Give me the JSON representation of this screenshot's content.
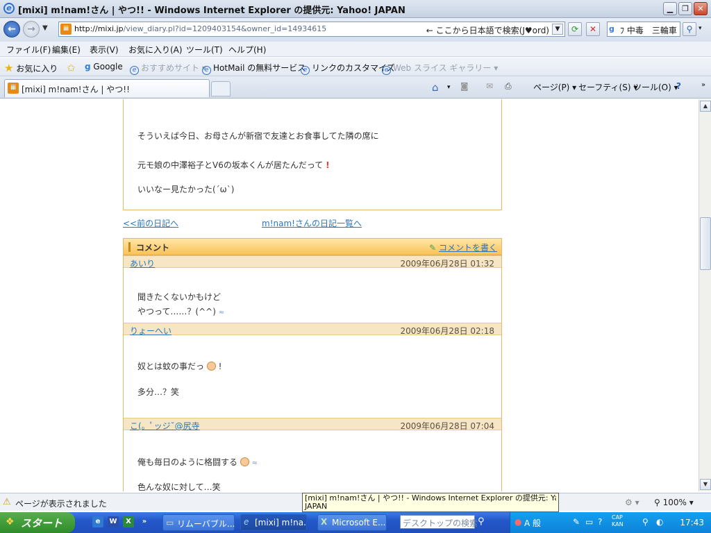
{
  "window": {
    "title": "[mixi] m!nam!さん | やつ!! - Windows Internet Explorer の提供元: Yahoo! JAPAN"
  },
  "address": {
    "host": "http://mixi.jp",
    "path": "/view_diary.pl?id=1209403154&owner_id=14934615",
    "jword": "← ここから日本語で検索(J♥ord)"
  },
  "search": {
    "value": "ﾌ 中毒　三輪車"
  },
  "menu": [
    "ファイル(F)",
    "編集(E)",
    "表示(V)",
    "お気に入り(A)",
    "ツール(T)",
    "ヘルプ(H)"
  ],
  "favorites_bar": {
    "favorites": "お気に入り",
    "items": [
      "Google",
      "おすすめサイト ▾",
      "HotMail の無料サービス",
      "リンクのカスタマイズ",
      "Web スライス ギャラリー ▾"
    ]
  },
  "tab": {
    "label": "[mixi] m!nam!さん | やつ!!"
  },
  "command_bar": {
    "page": "ページ(P) ▾",
    "safety": "セーフティ(S) ▾",
    "tools": "ツール(O) ▾"
  },
  "diary": {
    "lines": [
      "そういえば今日、お母さんが新宿で友達とお食事してた隣の席に",
      "元モ娘の中澤裕子とV6の坂本くんが居たんだって",
      "いいなー見たかった(´ω`)"
    ],
    "prev_link": "<<前の日記へ",
    "list_link": "m!nam!さんの日記一覧へ"
  },
  "comments": {
    "title": "コメント",
    "write_link": "コメントを書く",
    "items": [
      {
        "name": "あいり",
        "date": "2009年06月28日 01:32",
        "lines": [
          "聞きたくないかもけど",
          "やつって……？(^^)"
        ]
      },
      {
        "name": "りょーへい",
        "date": "2009年06月28日 02:18",
        "lines": [
          "奴とは蚊の事だっ",
          "多分…？笑"
        ]
      },
      {
        "name": "こ(。ﾟッジ˘@尻寺",
        "date": "2009年06月28日 07:04",
        "lines": [
          "俺も毎日のように格闘する",
          "色んな奴に対して…笑"
        ]
      }
    ]
  },
  "status": {
    "text": "ページが表示されました",
    "zoom": "100%"
  },
  "tooltip": {
    "line1": "[mixi] m!nam!さん | やつ!! - Windows Internet Explorer の提供元: Yahoo!",
    "line2": "JAPAN"
  },
  "taskbar": {
    "start": "スタート",
    "buttons": [
      "リムーバブル...",
      "[mixi] m!na...",
      "Microsoft E..."
    ],
    "desktop_search": "デスクトップの検索",
    "clock": "17:43",
    "ime": "A 般",
    "caps": "CAP KAN"
  }
}
